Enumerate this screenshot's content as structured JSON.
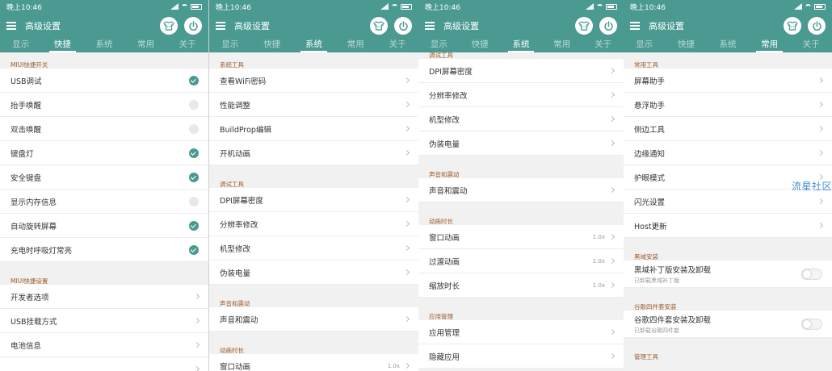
{
  "status": {
    "time": "晚上10:46"
  },
  "app": {
    "title": "高级设置"
  },
  "tabs": [
    "显示",
    "快捷",
    "系统",
    "常用",
    "关于"
  ],
  "watermark": "流星社区",
  "panel1": {
    "active_tab": 1,
    "sections": [
      {
        "header": "MIUI快捷开关",
        "items": [
          {
            "label": "USB调试",
            "control": "check"
          },
          {
            "label": "抬手唤醒",
            "control": "uncheck"
          },
          {
            "label": "双击唤醒",
            "control": "uncheck"
          },
          {
            "label": "键盘灯",
            "control": "check"
          },
          {
            "label": "安全键盘",
            "control": "check"
          },
          {
            "label": "显示内存信息",
            "control": "uncheck"
          },
          {
            "label": "自动旋转屏幕",
            "control": "check"
          },
          {
            "label": "充电时呼吸灯常亮",
            "control": "check"
          }
        ]
      },
      {
        "header": "MIUI快捷设置",
        "items": [
          {
            "label": "开发者选项",
            "control": "chevron"
          },
          {
            "label": "USB挂载方式",
            "control": "chevron"
          },
          {
            "label": "电池信息",
            "control": "chevron"
          },
          {
            "label": "",
            "control": "chevron"
          }
        ]
      }
    ]
  },
  "panel2": {
    "active_tab": 2,
    "sections": [
      {
        "header": "系统工具",
        "items": [
          {
            "label": "查看WiFi密码",
            "control": "chevron"
          },
          {
            "label": "性能调整",
            "control": "chevron"
          },
          {
            "label": "BuildProp编辑",
            "control": "chevron"
          },
          {
            "label": "开机动画",
            "control": "chevron"
          }
        ]
      },
      {
        "header": "调试工具",
        "items": [
          {
            "label": "DPI屏幕密度",
            "control": "chevron"
          },
          {
            "label": "分辨率修改",
            "control": "chevron"
          },
          {
            "label": "机型修改",
            "control": "chevron"
          },
          {
            "label": "伪装电量",
            "control": "chevron"
          }
        ]
      },
      {
        "header": "声音和震动",
        "items": [
          {
            "label": "声音和震动",
            "control": "chevron"
          }
        ]
      },
      {
        "header": "动画时长",
        "items": [
          {
            "label": "窗口动画",
            "control": "value",
            "value": "1.0x"
          }
        ]
      }
    ]
  },
  "panel3": {
    "active_tab": 2,
    "sections": [
      {
        "header": "调试工具",
        "items": [
          {
            "label": "DPI屏幕密度",
            "control": "chevron"
          },
          {
            "label": "分辨率修改",
            "control": "chevron"
          },
          {
            "label": "机型修改",
            "control": "chevron"
          },
          {
            "label": "伪装电量",
            "control": "chevron"
          }
        ]
      },
      {
        "header": "声音和震动",
        "items": [
          {
            "label": "声音和震动",
            "control": "chevron"
          }
        ]
      },
      {
        "header": "动画时长",
        "items": [
          {
            "label": "窗口动画",
            "control": "value",
            "value": "1.0x"
          },
          {
            "label": "过渡动画",
            "control": "value",
            "value": "1.0x"
          },
          {
            "label": "缩放时长",
            "control": "value",
            "value": "1.0x"
          }
        ]
      },
      {
        "header": "应用管理",
        "items": [
          {
            "label": "应用管理",
            "control": "chevron"
          },
          {
            "label": "隐藏应用",
            "control": "chevron"
          }
        ]
      }
    ]
  },
  "panel4": {
    "active_tab": 3,
    "sections": [
      {
        "header": "常用工具",
        "items": [
          {
            "label": "屏幕助手",
            "control": "chevron"
          },
          {
            "label": "悬浮助手",
            "control": "chevron"
          },
          {
            "label": "侧边工具",
            "control": "chevron"
          },
          {
            "label": "边缘通知",
            "control": "chevron"
          },
          {
            "label": "护眼模式",
            "control": "chevron"
          },
          {
            "label": "闪光设置",
            "control": "chevron"
          },
          {
            "label": "Host更新",
            "control": "chevron"
          }
        ]
      },
      {
        "header": "黑域安装",
        "items": [
          {
            "label": "黑域补丁版安装及卸载",
            "sub": "已卸载黑域补丁版",
            "control": "toggle",
            "on": false
          }
        ]
      },
      {
        "header": "谷歌四件套安装",
        "items": [
          {
            "label": "谷歌四件套安装及卸载",
            "sub": "已卸载谷歌四件套",
            "control": "toggle",
            "on": false
          }
        ]
      },
      {
        "header": "管理工具",
        "items": []
      }
    ]
  },
  "colors": {
    "primary": "#4a9a92",
    "section_header": "#a05a2a",
    "watermark": "#3d8fd6"
  }
}
